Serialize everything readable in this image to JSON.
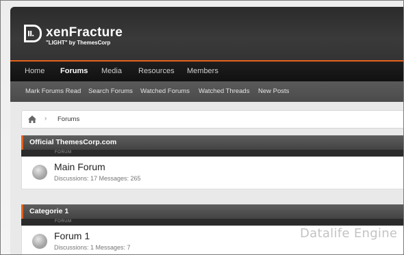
{
  "brand": {
    "name_prefix": "xen",
    "name_main": "Fracture",
    "tagline": "\"LIGHT\" by ThemesCorp",
    "logo_mark": "II."
  },
  "nav": {
    "tabs": [
      {
        "label": "Home"
      },
      {
        "label": "Forums",
        "active": true
      },
      {
        "label": "Media"
      },
      {
        "label": "Resources"
      },
      {
        "label": "Members"
      }
    ]
  },
  "subnav": {
    "items": [
      {
        "label": "Mark Forums Read"
      },
      {
        "label": "Search Forums"
      },
      {
        "label": "Watched Forums"
      },
      {
        "label": "Watched Threads"
      },
      {
        "label": "New Posts"
      }
    ]
  },
  "breadcrumb": {
    "separator": "›",
    "current": "Forums",
    "home_icon": "home-icon"
  },
  "categories": [
    {
      "title": "Official ThemesCorp.com",
      "column_label": "FORUM",
      "forum": {
        "title": "Main Forum",
        "stats": "Discussions: 17 Messages: 265"
      }
    },
    {
      "title": "Categorie 1",
      "column_label": "FORUM",
      "forum": {
        "title": "Forum 1",
        "stats": "Discussions: 1 Messages: 7"
      }
    }
  ],
  "watermark": "Datalife Engine",
  "colors": {
    "accent": "#e8611c",
    "header_bg": "#333333",
    "nav_bg": "#161616",
    "subnav_bg": "#515151"
  }
}
